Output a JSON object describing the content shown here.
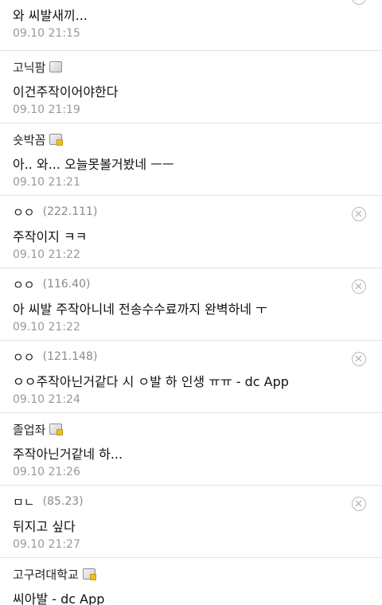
{
  "comments": [
    {
      "nick": "",
      "ip": "",
      "badge": "",
      "body": "와 씨발새끼...",
      "date": "09.10 21:15",
      "deletable": true
    },
    {
      "nick": "고닉팜",
      "ip": "",
      "badge": "fixed",
      "body": "이건주작이어야한다",
      "date": "09.10 21:19",
      "deletable": false
    },
    {
      "nick": "숏박꼼",
      "ip": "",
      "badge": "gallery",
      "body": "아.. 와... 오늘못볼거봤네 ㅡㅡ",
      "date": "09.10 21:21",
      "deletable": false
    },
    {
      "nick": "ㅇㅇ",
      "ip": "(222.111)",
      "badge": "",
      "body": "주작이지 ㅋㅋ",
      "date": "09.10 21:22",
      "deletable": true
    },
    {
      "nick": "ㅇㅇ",
      "ip": "(116.40)",
      "badge": "",
      "body": "아 씨발 주작아니네 전송수수료까지 완벽하네 ㅜ",
      "date": "09.10 21:22",
      "deletable": true
    },
    {
      "nick": "ㅇㅇ",
      "ip": "(121.148)",
      "badge": "",
      "body": "ㅇㅇ주작아닌거같다 시 ㅇ발 하 인생 ㅠㅠ - dc App",
      "date": "09.10 21:24",
      "deletable": true
    },
    {
      "nick": "졸업좌",
      "ip": "",
      "badge": "gallery",
      "body": "주작아닌거같네 하...",
      "date": "09.10 21:26",
      "deletable": false
    },
    {
      "nick": "ㅁㄴ",
      "ip": "(85.23)",
      "badge": "",
      "body": "뒤지고 싶다",
      "date": "09.10 21:27",
      "deletable": true
    },
    {
      "nick": "고구려대학교",
      "ip": "",
      "badge": "gallery",
      "body": "씨아발 - dc App",
      "date": "",
      "deletable": false
    }
  ]
}
